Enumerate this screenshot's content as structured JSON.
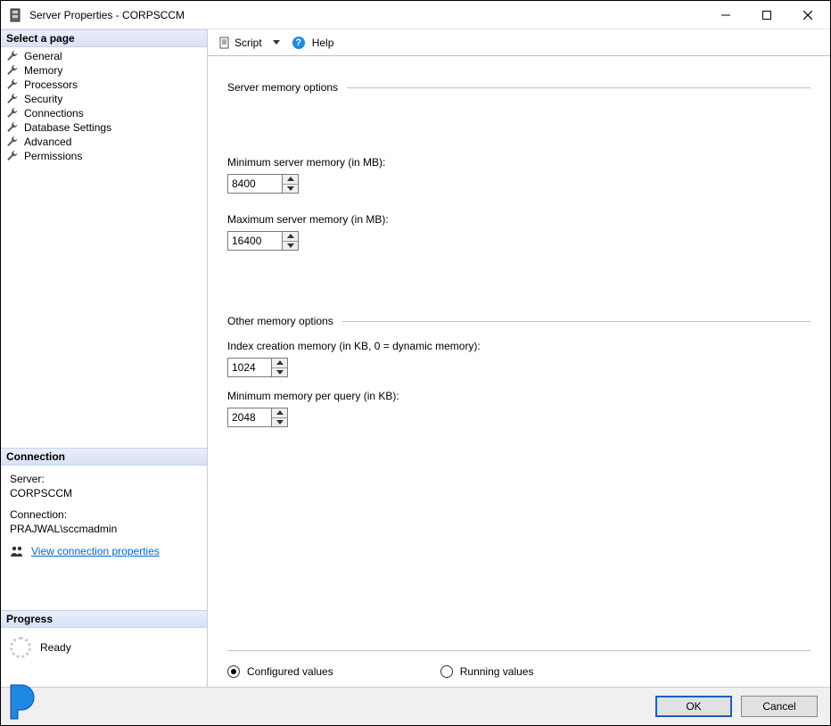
{
  "window": {
    "title": "Server Properties - CORPSCCM"
  },
  "toolbar": {
    "script_label": "Script",
    "help_label": "Help"
  },
  "sidebar": {
    "header": "Select a page",
    "items": [
      {
        "label": "General"
      },
      {
        "label": "Memory"
      },
      {
        "label": "Processors"
      },
      {
        "label": "Security"
      },
      {
        "label": "Connections"
      },
      {
        "label": "Database Settings"
      },
      {
        "label": "Advanced"
      },
      {
        "label": "Permissions"
      }
    ]
  },
  "connection": {
    "header": "Connection",
    "server_label": "Server:",
    "server_value": "CORPSCCM",
    "conn_label": "Connection:",
    "conn_value": "PRAJWAL\\sccmadmin",
    "link": "View connection properties"
  },
  "progress": {
    "header": "Progress",
    "status": "Ready"
  },
  "content": {
    "group1": "Server memory options",
    "min_mem_label": "Minimum server memory (in MB):",
    "min_mem_value": "8400",
    "max_mem_label": "Maximum server memory (in MB):",
    "max_mem_value": "16400",
    "group2": "Other memory options",
    "index_label": "Index creation memory (in KB, 0 = dynamic memory):",
    "index_value": "1024",
    "query_label": "Minimum memory per query (in KB):",
    "query_value": "2048",
    "radio_configured": "Configured values",
    "radio_running": "Running values"
  },
  "footer": {
    "ok": "OK",
    "cancel": "Cancel"
  }
}
